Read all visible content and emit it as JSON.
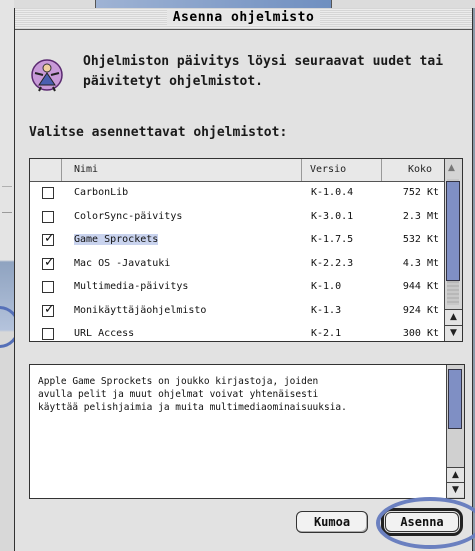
{
  "dialog": {
    "title": "Asenna ohjelmisto",
    "intro_line1": "Ohjelmiston päivitys löysi seuraavat uudet tai",
    "intro_line2": "päivitetyt ohjelmistot.",
    "section_label": "Valitse asennettavat ohjelmistot:"
  },
  "table": {
    "headers": {
      "name": "Nimi",
      "version": "Versio",
      "size": "Koko"
    },
    "rows": [
      {
        "name": "CarbonLib",
        "version": "K-1.0.4",
        "size": "752 Kt",
        "checked": false,
        "selected": false
      },
      {
        "name": "ColorSync-päivitys",
        "version": "K-3.0.1",
        "size": "2.3 Mt",
        "checked": false,
        "selected": false
      },
      {
        "name": "Game Sprockets",
        "version": "K-1.7.5",
        "size": "532 Kt",
        "checked": true,
        "selected": true
      },
      {
        "name": "Mac OS -Javatuki",
        "version": "K-2.2.3",
        "size": "4.3 Mt",
        "checked": true,
        "selected": false
      },
      {
        "name": "Multimedia-päivitys",
        "version": "K-1.0",
        "size": "944 Kt",
        "checked": false,
        "selected": false
      },
      {
        "name": "Monikäyttäjäohjelmisto",
        "version": "K-1.3",
        "size": "924 Kt",
        "checked": true,
        "selected": false
      },
      {
        "name": "URL Access",
        "version": "K-2.1",
        "size": "300 Kt",
        "checked": false,
        "selected": false
      }
    ]
  },
  "description": {
    "line1": "Apple Game Sprockets on joukko kirjastoja, joiden",
    "line2": "avulla pelit ja muut ohjelmat voivat yhtenäisesti",
    "line3": "käyttää pelishjaimia ja muita multimediaominaisuuksia."
  },
  "buttons": {
    "cancel": "Kumoa",
    "install": "Asenna"
  },
  "colors": {
    "selection": "#c9d3ee",
    "scroll_thumb": "#7f8fc4",
    "highlight": "#6b80c0"
  }
}
